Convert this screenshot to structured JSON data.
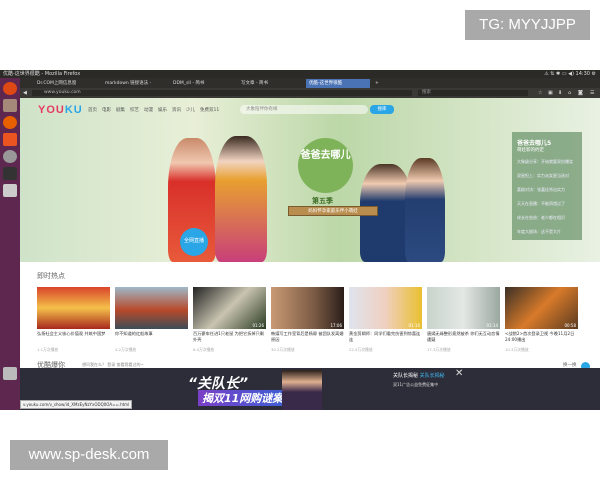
{
  "watermarks": {
    "top": "TG: MYYJJPP",
    "bottom": "www.sp-desk.com"
  },
  "os": {
    "window_title": "优酷-这世界很酷 - Mozilla Firefox",
    "clock": "14:30",
    "tray": "⚠ ⇅ ✱ ▭ ◀) 14:30 ⚙"
  },
  "browser": {
    "tabs": [
      {
        "label": "Dr.COM上网信息窗",
        "active": false
      },
      {
        "label": "markdown 链接语法 - ",
        "active": false
      },
      {
        "label": "DDM_sll - 简书",
        "active": false
      },
      {
        "label": "写文章 - 简书",
        "active": false
      },
      {
        "label": "优酷-这世界很酷",
        "active": true
      }
    ],
    "new_tab": "+",
    "url": "www.youku.com",
    "search_placeholder": "搜索",
    "toolbar_icons": [
      "star-icon",
      "clipboard-icon",
      "download-icon",
      "home-icon",
      "pocket-icon",
      "menu-icon"
    ]
  },
  "youku": {
    "logo": "YOU",
    "logo2": "KU",
    "nav": [
      "首页",
      "电影",
      "剧集",
      "综艺",
      "动漫",
      "娱乐",
      "资讯",
      "少儿",
      "免费双11"
    ],
    "search_placeholder": "大象陪伴你有样",
    "search_button": "搜库",
    "hero": {
      "show_logo": "爸爸去哪儿",
      "season": "第五季",
      "slogan": "妈妈怀孕家庭乐伴小萌娃",
      "live_badge": "全网直播"
    },
    "side_panel": {
      "title": "爸爸去哪儿5",
      "subtitle": "萌娃新的约定",
      "items": [
        "大象级分享：开始就要双倍爆笑",
        "双星担上：实力派女星当选对",
        "喜剧对决：张嘉佳秀出实力",
        "天天在直播：不能再错过了",
        "成长在爸爸：老少都在相识",
        "年度大剧场：这不是大片"
      ]
    },
    "section1": {
      "title": "即时热点",
      "videos": [
        {
          "title": "弘扬社会主义核心价值观 共筑中国梦",
          "views": "1.1万次播放",
          "duration": ""
        },
        {
          "title": "你不知道的红船故事",
          "views": "4.2万次播放",
          "duration": ""
        },
        {
          "title": "百万豪车任进1只老鼠 为把它拆掉只剩外壳",
          "views": "6.0万次播放",
          "duration": "01:26"
        },
        {
          "title": "韩媒写工作室背后是杨幂 被团队发离婚原因",
          "views": "30.2万次播放",
          "duration": "17:06"
        },
        {
          "title": "黄金剪辑师：同学们看完伤害到惊喜连连",
          "views": "22.5万次播放",
          "duration": "01:10"
        },
        {
          "title": "唐嫣无缘整形竟然被杀 你们无互动恋情遭疑",
          "views": "17.3万次播放",
          "duration": "01:14"
        },
        {
          "title": "<战狼2>首次登录卫视 今晚11月2日24:00播出",
          "views": "10.3万次播放",
          "duration": "00:58"
        }
      ]
    },
    "section2": {
      "title": "优酷爆你",
      "subtitle": "想问我在么？ 登录 查看我看过的~",
      "more": "换一换"
    }
  },
  "ad": {
    "headline": "“关队长”",
    "subline": "揭双11网购谜案",
    "text1": "关队长揭秘",
    "text1_highlight": "关队长揭秘",
    "text2": "双11广告公益免费征集中",
    "close": "✕"
  },
  "status_url": "v.youku.com/v_show/id_XMzEyNzYxODQ0OA==.html"
}
